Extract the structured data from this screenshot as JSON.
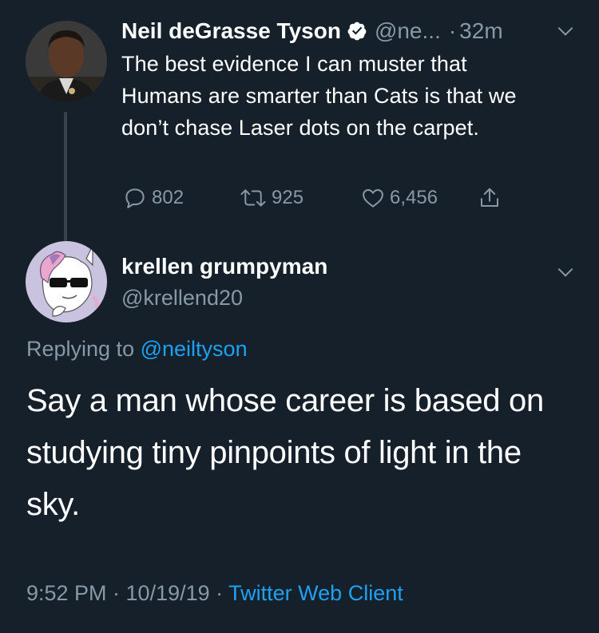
{
  "original_tweet": {
    "display_name": "Neil deGrasse Tyson",
    "handle": "@ne...",
    "separator": "·",
    "time_ago": "32m",
    "text": "The best evidence I can muster that Humans are smarter than Cats is that we don’t chase Laser dots on the carpet.",
    "reply_count": "802",
    "retweet_count": "925",
    "like_count": "6,456"
  },
  "reply_tweet": {
    "display_name": "krellen grumpyman",
    "handle": "@krellend20",
    "replying_to_prefix": "Replying to",
    "replying_to_handle": "@neiltyson",
    "text": "Say a man whose career is based on studying tiny pinpoints of light in the sky.",
    "timestamp": "9:52 PM · 10/19/19 ·",
    "source": "Twitter Web Client"
  },
  "colors": {
    "background": "#15202b",
    "text_primary": "#ffffff",
    "text_secondary": "#8899a6",
    "link_blue": "#1da1f2",
    "thread_line": "#38444d"
  },
  "icons": [
    "verified-badge-icon",
    "chevron-down-icon",
    "reply-icon",
    "retweet-icon",
    "like-icon",
    "share-icon"
  ]
}
